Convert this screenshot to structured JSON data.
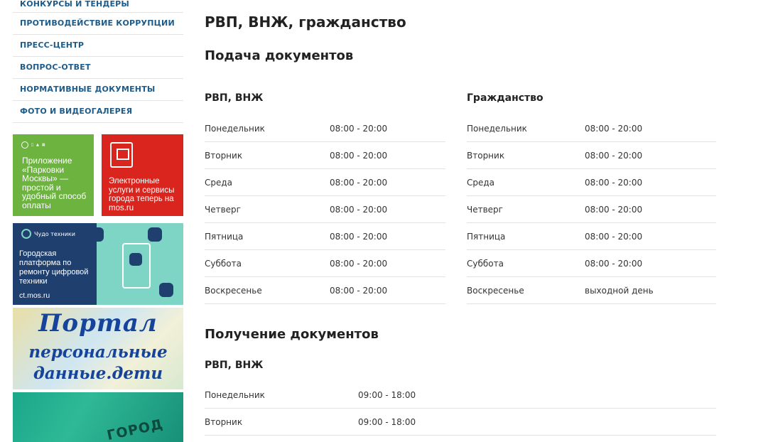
{
  "sidebar": {
    "nav_items": [
      "КОНКУРСЫ И ТЕНДЕРЫ",
      "ПРОТИВОДЕЙСТВИЕ КОРРУПЦИИ",
      "ПРЕСС-ЦЕНТР",
      "ВОПРОС-ОТВЕТ",
      "НОРМАТИВНЫЕ ДОКУМЕНТЫ",
      "ФОТО И ВИДЕОГАЛЕРЕЯ"
    ],
    "banners": {
      "parking_text": "Приложение «Парковки Москвы» — простой и удобный способ оплаты",
      "mosru_text": "Электронные услуги и сервисы города теперь на mos.ru",
      "chudo_logo": "Чудо техники",
      "chudo_text": "Городская платформа по ремонту цифровой техники",
      "chudo_url": "ct.mos.ru",
      "portal_line1": "Портал",
      "portal_line2": "персональные",
      "portal_line3": "данные.дети",
      "green_big_text": "ГОРОД"
    },
    "colors": {
      "nav_link": "#1d5c8a",
      "green": "#6cb33f",
      "red": "#d9251d",
      "navy": "#1f3f6e",
      "teal": "#7ed5c6"
    }
  },
  "main": {
    "title": "РВП, ВНЖ, гражданство",
    "submission": {
      "heading": "Подача документов",
      "rvp": {
        "title": "РВП, ВНЖ",
        "rows": [
          {
            "day": "Понедельник",
            "time": "08:00 - 20:00"
          },
          {
            "day": "Вторник",
            "time": "08:00 - 20:00"
          },
          {
            "day": "Среда",
            "time": "08:00 - 20:00"
          },
          {
            "day": "Четверг",
            "time": "08:00 - 20:00"
          },
          {
            "day": "Пятница",
            "time": "08:00 - 20:00"
          },
          {
            "day": "Суббота",
            "time": "08:00 - 20:00"
          },
          {
            "day": "Воскресенье",
            "time": "08:00 - 20:00"
          }
        ]
      },
      "citizenship": {
        "title": "Гражданство",
        "rows": [
          {
            "day": "Понедельник",
            "time": "08:00 - 20:00"
          },
          {
            "day": "Вторник",
            "time": "08:00 - 20:00"
          },
          {
            "day": "Среда",
            "time": "08:00 - 20:00"
          },
          {
            "day": "Четверг",
            "time": "08:00 - 20:00"
          },
          {
            "day": "Пятница",
            "time": "08:00 - 20:00"
          },
          {
            "day": "Суббота",
            "time": "08:00 - 20:00"
          },
          {
            "day": "Воскресенье",
            "time": "выходной день"
          }
        ]
      }
    },
    "receipt": {
      "heading": "Получение документов",
      "rvp": {
        "title": "РВП, ВНЖ",
        "rows": [
          {
            "day": "Понедельник",
            "time": "09:00 - 18:00"
          },
          {
            "day": "Вторник",
            "time": "09:00 - 18:00"
          }
        ]
      }
    }
  }
}
